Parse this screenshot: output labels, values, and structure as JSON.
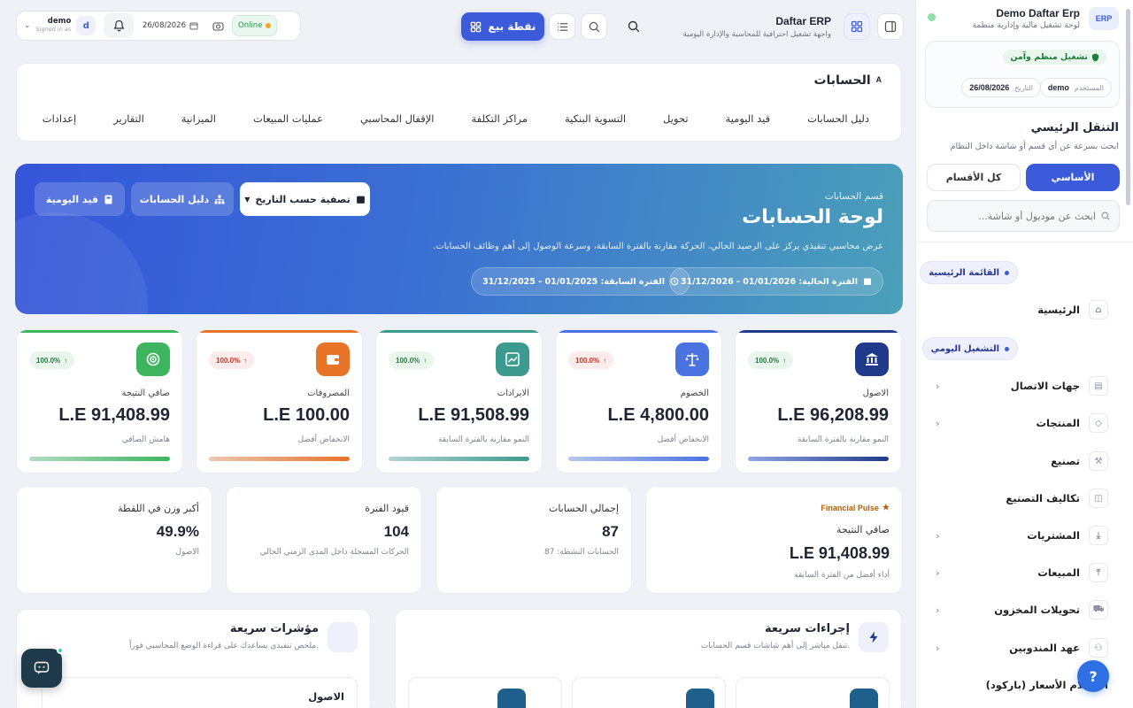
{
  "app": {
    "title": "Daftar ERP",
    "subtitle": "واجهة تشغيل احترافية للمحاسبة والإدارة اليومية"
  },
  "topbar": {
    "pos_label": "نقطة بيع",
    "user_name": "demo",
    "user_status": "Signed in as",
    "user_initial": "d",
    "date": "26/08/2026",
    "online_label": "Online"
  },
  "sidebar": {
    "badge": "ERP",
    "brand_title": "Demo Daftar Erp",
    "brand_subtitle": "لوحة تشغيل مالية وإدارية منظمة",
    "secure_label": "تشغيل منظم وآمن",
    "user_label": "المستخدم",
    "user_value": "demo",
    "date_label": "التاريخ",
    "date_value": "26/08/2026",
    "nav_heading": "التنقل الرئيسي",
    "nav_sub": "ابحث بسرعة عن أي قسم أو شاشة داخل النظام",
    "tabs": [
      {
        "label": "الأساسي"
      },
      {
        "label": "كل الأقسام"
      }
    ],
    "search_placeholder": "ابحث عن موديول أو شاشة...",
    "group_main": "القائمة الرئيسية",
    "group_daily": "التشغيل اليومي",
    "items": [
      {
        "label": "الرئيسية",
        "icon": "home-icon"
      },
      {
        "label": "جهات الاتصال",
        "icon": "contacts-icon"
      },
      {
        "label": "المنتجات",
        "icon": "box-icon"
      },
      {
        "label": "تصنيع",
        "icon": "factory-icon"
      },
      {
        "label": "تكاليف التصنيع",
        "icon": "cost-icon"
      },
      {
        "label": "المشتريات",
        "icon": "download-icon"
      },
      {
        "label": "المبيعات",
        "icon": "upload-icon"
      },
      {
        "label": "تحويلات المخزون",
        "icon": "truck-icon"
      },
      {
        "label": "عهد المندوبين",
        "icon": "people-icon"
      },
      {
        "label": "استعلام الأسعار (باركود)",
        "icon": "barcode-icon"
      }
    ]
  },
  "page": {
    "title": "الحسابات",
    "menu": [
      "دليل الحسابات",
      "قيد اليومية",
      "تحويل",
      "التسوية البنكية",
      "مراكز التكلفة",
      "الإقفال المحاسبي",
      "عمليات المبيعات",
      "الميزانية",
      "التقارير",
      "إعدادات"
    ]
  },
  "hero": {
    "kicker": "قسم الحسابات",
    "title": "لوحة الحسابات",
    "description": "عرض محاسبي تنفيذي يركز على الرصيد الحالي، الحركة مقارنة بالفترة السابقة، وسرعة الوصول إلى أهم وظائف الحسابات.",
    "current_period": "الفترة الحالية: 01/01/2026 - 31/12/2026",
    "previous_period": "الفترة السابقة: 01/01/2025 - 31/12/2025",
    "filter_label": "تصفية حسب التاريخ",
    "chart_accounts_label": "دليل الحسابات",
    "journal_label": "قيد اليومية"
  },
  "kpis": [
    {
      "label": "الاصول",
      "value": "L.E 96,208.99",
      "change": "100.0%",
      "sub": "النمو مقارنة بالفترة السابقة",
      "color": "#1f3a8a",
      "bar_fill": 1.0,
      "trend": "up"
    },
    {
      "label": "الخصوم",
      "value": "L.E 4,800.00",
      "change": "100.0%",
      "sub": "الانخفاض أفضل",
      "color": "#4a72e0",
      "bar_fill": 1.0,
      "trend": "up"
    },
    {
      "label": "الايرادات",
      "value": "L.E 91,508.99",
      "change": "100.0%",
      "sub": "النمو مقارنة بالفترة السابقة",
      "color": "#3d9a8f",
      "bar_fill": 1.0,
      "trend": "up"
    },
    {
      "label": "المصروفات",
      "value": "L.E 100.00",
      "change": "100.0%",
      "sub": "الانخفاض أفضل",
      "color": "#e8742a",
      "bar_fill": 1.0,
      "trend": "up"
    },
    {
      "label": "صافي النتيجة",
      "value": "L.E 91,408.99",
      "change": "100.0%",
      "sub": "هامش الصافي",
      "color": "#3cb55e",
      "bar_fill": 1.0,
      "trend": "up"
    }
  ],
  "stats": [
    {
      "tag": "Financial Pulse",
      "label": "صافي النتيجة",
      "value": "L.E 91,408.99",
      "sub": "أداء أفضل من الفترة السابقة"
    },
    {
      "label": "إجمالي الحسابات",
      "value": "87",
      "sub": "الحسابات النشطة: 87"
    },
    {
      "label": "قيود الفترة",
      "value": "104",
      "sub": "الحركات المسجلة داخل المدى الزمني الحالي"
    },
    {
      "label": "أكبر وزن في اللقطة",
      "value": "49.9%",
      "sub": "الاصول"
    }
  ],
  "quick_actions": {
    "title": "إجراءات سريعة",
    "sub": "تنقل مباشر إلى أهم شاشات قسم الحسابات."
  },
  "quick_indicators": {
    "title": "مؤشرات سريعة",
    "sub": "ملخص تنفيذي يساعدك على قراءة الوضع المحاسبي فوراً.",
    "first_row": "الاصول"
  },
  "help_label": "?"
}
